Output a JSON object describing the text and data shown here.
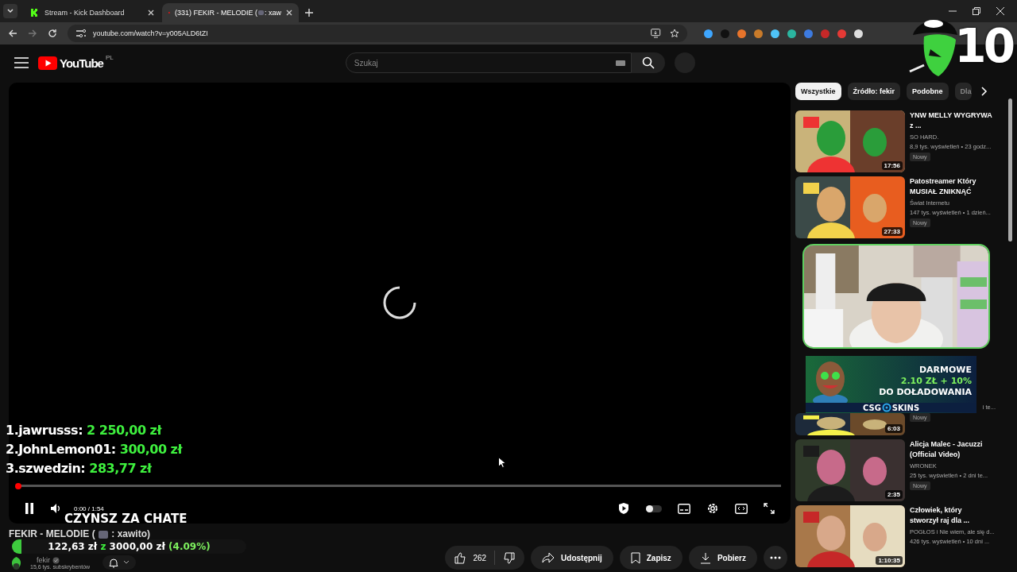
{
  "browser": {
    "tabs": [
      {
        "title": "Stream - Kick Dashboard",
        "selected": false,
        "kind": "kick"
      },
      {
        "title": "(331) FEKIR - MELODIE ( ",
        "title_after": " : xaw",
        "selected": true,
        "kind": "youtube"
      }
    ],
    "url": "youtube.com/watch?v=y005ALD6tZI"
  },
  "stream_badge": {
    "text": "10"
  },
  "header": {
    "logo": "YouTube",
    "region": "PL",
    "search": {
      "placeholder": "Szukaj"
    }
  },
  "chips": [
    {
      "label": "Wszystkie",
      "selected": true
    },
    {
      "label": "Źródło: fekir",
      "selected": false
    },
    {
      "label": "Podobne",
      "selected": false
    },
    {
      "label": "Dla",
      "selected": false
    }
  ],
  "recommendations": [
    {
      "kind": "video",
      "title": "YNW MELLY WYGRYWA z ...",
      "channel": "SO HARD.",
      "meta": "8,9 tys. wyświetleń • 23 godz...",
      "badge": "Nowy",
      "duration": "17:56"
    },
    {
      "kind": "video",
      "title": "Patostreamer Który MUSIAŁ ZNIKNĄĆ",
      "channel": "Świat Internetu",
      "meta": "147 tys. wyświetleń • 1 dzień...",
      "badge": "Nowy",
      "duration": "27:33"
    },
    {
      "kind": "webcam"
    },
    {
      "kind": "video",
      "meta": "i te...",
      "badge": "Nowy",
      "duration": "6:03",
      "ad": {
        "lines": [
          "DARMOWE",
          "2.10 ZŁ + 10%",
          "DO DOŁADOWANIA"
        ],
        "brand_left": "CSG",
        "brand_right": "SKINS"
      }
    },
    {
      "kind": "video",
      "title": "Alicja Malec - Jacuzzi (Official Video)",
      "channel": "WRONEK",
      "meta": "25 tys. wyświetleń • 2 dni te...",
      "badge": "Nowy",
      "duration": "2:35"
    },
    {
      "kind": "video",
      "title": "Człowiek, który stworzył raj dla ...",
      "channel": "POGŁOS i Nie wiem, ale się d...",
      "meta": "426 tys. wyświetleń • 10 dni ...",
      "duration": "1:10:35"
    }
  ],
  "player": {
    "loading": true,
    "playing": true,
    "autoplay": {
      "on": false
    },
    "time": "0:00 / 1:54",
    "progress": {
      "level": 0
    },
    "caption": "CZYNSZ ZA CHATE",
    "donations": [
      {
        "rank": "1.",
        "name": "jawrusss:",
        "amount": "2 250,00 zł"
      },
      {
        "rank": "2.",
        "name": "JohnLemon01:",
        "amount": "300,00 zł"
      },
      {
        "rank": "3.",
        "name": "szwedzin:",
        "amount": "283,77 zł"
      }
    ]
  },
  "video": {
    "title_before": "FEKIR - MELODIE ( ",
    "title_after": " : xawito)",
    "goal": {
      "raised": "122,63 zł",
      "sep": "z",
      "target": "3000,00 zł",
      "percent": "(4.09%)",
      "level": 0.0409
    },
    "channel": {
      "name": "fekir",
      "verified": true,
      "subscribers": "15,6 tys. subskrybentów"
    },
    "likes": "262",
    "actions": [
      {
        "kind": "share",
        "label": "Udostępnij"
      },
      {
        "kind": "save",
        "label": "Zapisz"
      },
      {
        "kind": "download",
        "label": "Pobierz"
      }
    ]
  }
}
